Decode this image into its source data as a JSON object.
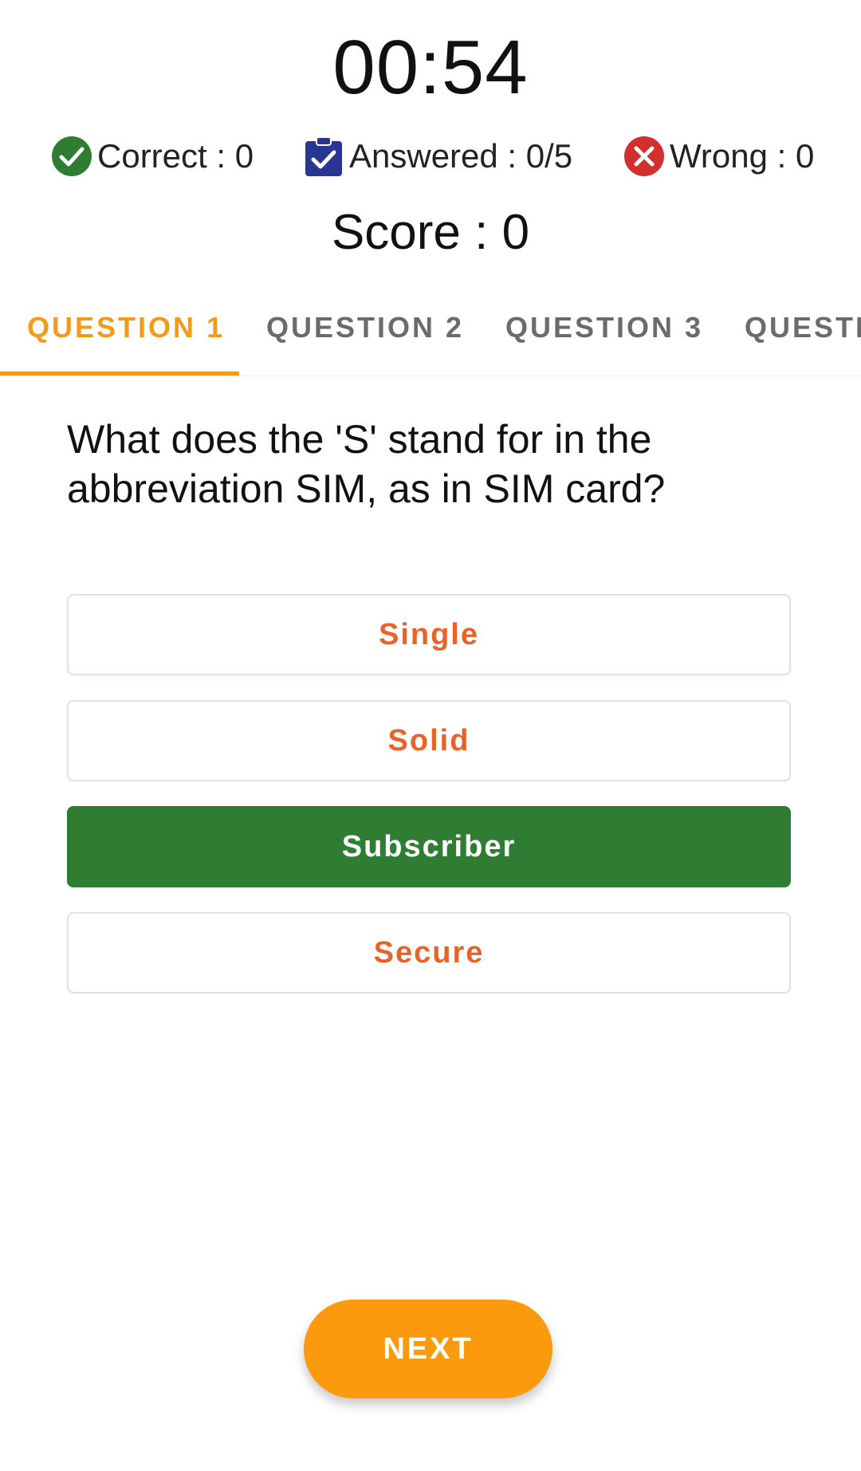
{
  "timer": {
    "value": "00:54"
  },
  "stats": {
    "correct": {
      "label": "Correct : 0",
      "icon": "check-circle-icon",
      "color": "#2e7d32"
    },
    "answered": {
      "label": "Answered : 0/5",
      "icon": "clipboard-check-icon",
      "color": "#283593"
    },
    "wrong": {
      "label": "Wrong : 0",
      "icon": "cancel-circle-icon",
      "color": "#d32f2f"
    }
  },
  "score": {
    "label": "Score : 0"
  },
  "tabs": [
    {
      "label": "QUESTION 1",
      "active": true
    },
    {
      "label": "QUESTION 2",
      "active": false
    },
    {
      "label": "QUESTION 3",
      "active": false
    },
    {
      "label": "QUESTI",
      "active": false
    }
  ],
  "question": {
    "text": "What does the 'S' stand for in the abbreviation SIM, as in SIM card?"
  },
  "options": [
    {
      "label": "Single",
      "selected": false
    },
    {
      "label": "Solid",
      "selected": false
    },
    {
      "label": "Subscriber",
      "selected": true
    },
    {
      "label": "Secure",
      "selected": false
    }
  ],
  "next_button": {
    "label": "NEXT"
  },
  "colors": {
    "accent": "#f39a1b",
    "option_text": "#e8632a",
    "selected_bg": "#2e7d32",
    "next_bg": "#fb9a0c"
  }
}
